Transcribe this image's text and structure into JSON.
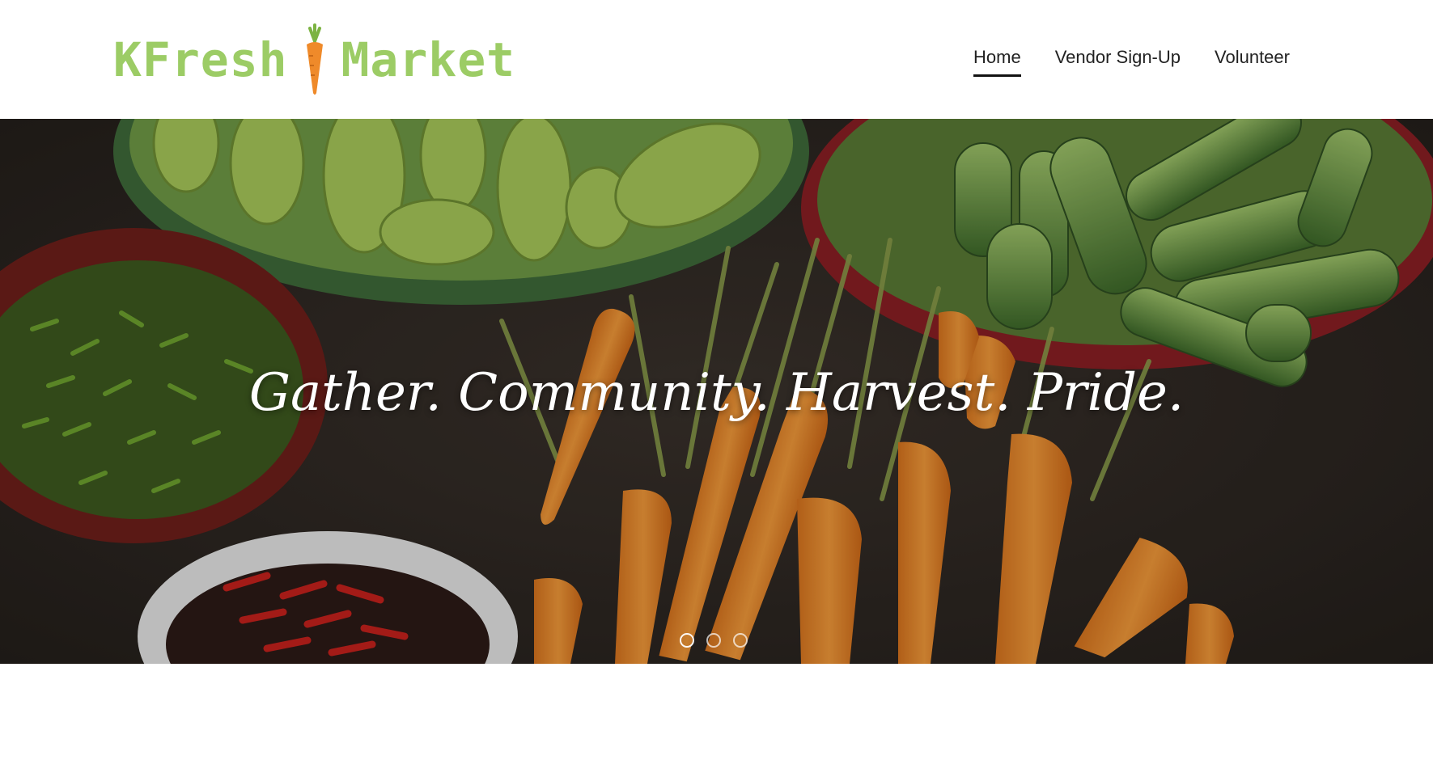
{
  "brand": {
    "name_part1": "KFresh",
    "name_part2": "Market",
    "logo_icon": "carrot-icon",
    "accent_color": "#9ccc65"
  },
  "nav": {
    "items": [
      {
        "label": "Home",
        "active": true
      },
      {
        "label": "Vendor Sign-Up",
        "active": false
      },
      {
        "label": "Volunteer",
        "active": false
      }
    ]
  },
  "hero": {
    "headline": "Gather. Community. Harvest. Pride.",
    "image_subject": "vegetables-market-photo",
    "slides": [
      {
        "active": true
      },
      {
        "active": false
      },
      {
        "active": false
      }
    ]
  }
}
